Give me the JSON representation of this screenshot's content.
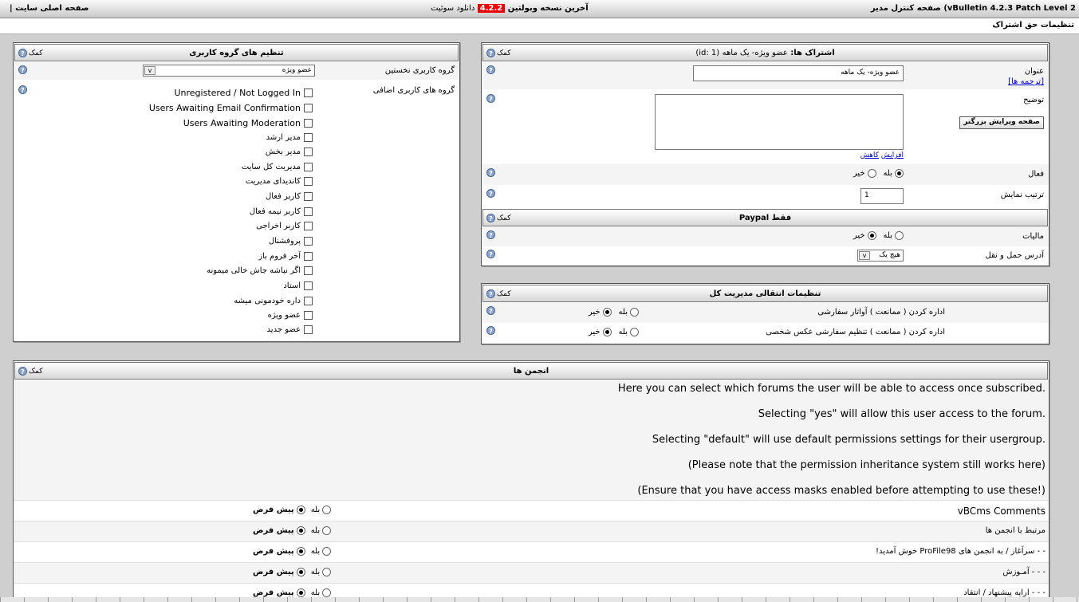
{
  "top": {
    "right": "vBulletin 4.2.3 Patch Level 2) صفحه کنترل مدیر",
    "mid_text": "آخرین نسخه وبولتین",
    "version": "4.2.2",
    "download": "دانلود سوئیت",
    "left": "صفحه اصلی سایت |"
  },
  "page_title": "تنظیمات حق اشتراک",
  "help_label": "کمک",
  "sub": {
    "header_title": "اشتراک ها:",
    "header_name": "عضو ویژه- یک ماهه",
    "header_id": "(id: 1)",
    "title_label": "عنوان",
    "translations_link": "[ترجمه ها]",
    "title_value": "عضو ویژه- یک ماهه",
    "desc_label": "توضیح",
    "editor_button": "صفحه ویرایش بزرگتر",
    "increase_link": "افزایش",
    "decrease_link": "کاهش",
    "active_label": "فعال",
    "yes": "بله",
    "no": "خیر",
    "order_label": "ترتیب نمایش",
    "order_value": "1"
  },
  "paypal": {
    "title": "فقط Paypal",
    "tax_label": "مالیات",
    "ship_label": "آدرس حمل و نقل",
    "ship_value": "هیچ یک"
  },
  "admin": {
    "title": "تنظیمات انتقالی مدیریت کل",
    "row1": "اداره کردن ( ممانعت ) آواتار سفارشی",
    "row2": "اداره کردن ( ممانعت ) تنظیم سفارشی عکس شخصی"
  },
  "usergroup": {
    "title": "تنظیم های گروه کاربری",
    "primary_label": "گروه کاربری نخستین",
    "primary_value": "عضو ویژه",
    "additional_label": "گروه های کاربری اضافی",
    "groups": [
      "Unregistered / Not Logged In",
      "Users Awaiting Email Confirmation",
      "Users Awaiting Moderation",
      "مدیر ارشد",
      "مدیر بخش",
      "مدیریت کل سایت",
      "کاندیدای مدیریت",
      "کاربر فعال",
      "کاربر نیمه فعال",
      "کاربر اخراجی",
      "پروفشنال",
      "آخر فروم باز",
      "اگر نباشه جاش خالی میمونه",
      "استاد",
      "داره خودمونی میشه",
      "عضو ویژه",
      "عضو جدید"
    ]
  },
  "forums": {
    "title": "انجمن ها",
    "desc": [
      "Here you can select which forums the user will be able to access once subscribed.",
      "Selecting \"yes\" will allow this user access to the forum.",
      "Selecting \"default\" will use default permissions settings for their usergroup.",
      "(Please note that the permission inheritance system still works here)",
      "(Ensure that you have access masks enabled before attempting to use these!)"
    ],
    "yes": "بله",
    "default": "پیش فرض",
    "rows": [
      "vBCms Comments",
      "مرتبط با انجمن ها",
      "- - سرآغاز / به انجمن های ProFile98 خوش آمدید!",
      "- - - آمـوزش",
      "- - - ارایه پیشنهاد / انتقاد"
    ]
  }
}
